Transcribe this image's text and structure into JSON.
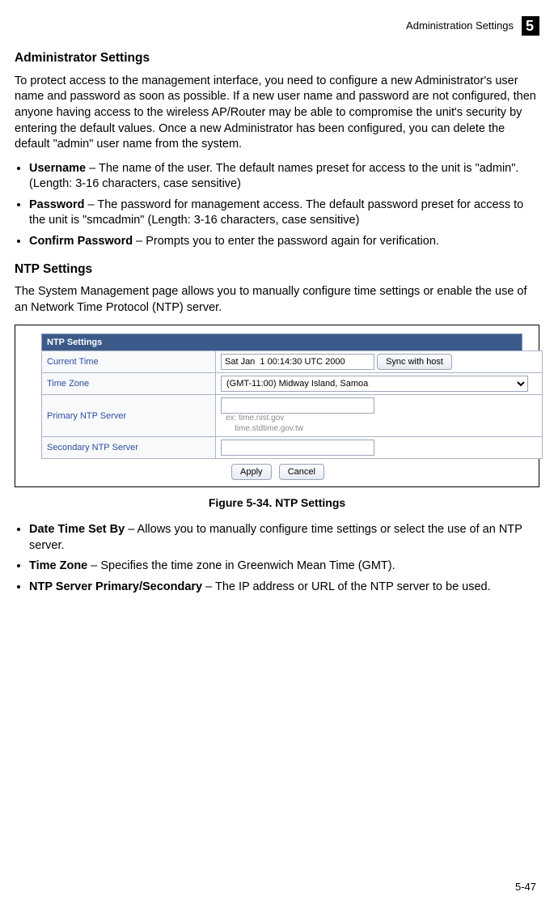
{
  "header": {
    "title": "Administration Settings",
    "chapter": "5"
  },
  "admin": {
    "heading": "Administrator Settings",
    "para": "To protect access to the management interface, you need to configure a new Administrator's user name and password as soon as possible. If a new user name and password are not configured, then anyone having access to the wireless AP/Router may be able to compromise the unit's security by entering the default values. Once a new Administrator has been configured, you can delete the default \"admin\" user name from the system.",
    "items": [
      {
        "label": "Username",
        "text": " – The name of the user. The default names preset for access to the unit is \"admin\". (Length: 3-16 characters, case sensitive)"
      },
      {
        "label": "Password",
        "text": " – The password for management access. The default password preset for access to the unit is \"smcadmin\" (Length: 3-16 characters, case sensitive)"
      },
      {
        "label": "Confirm Password",
        "text": " – Prompts you to enter the password again for verification."
      }
    ]
  },
  "ntp": {
    "heading": "NTP Settings",
    "intro": "The System Management page allows you to manually configure time settings or enable the use of an Network Time Protocol (NTP) server.",
    "panel_title": "NTP Settings",
    "rows": {
      "current_time_label": "Current Time",
      "current_time_value": "Sat Jan  1 00:14:30 UTC 2000",
      "sync_btn": "Sync with host",
      "tz_label": "Time Zone",
      "tz_value": "(GMT-11:00) Midway Island, Samoa",
      "primary_label": "Primary NTP Server",
      "primary_value": "",
      "primary_hint1": "ex: time.nist.gov",
      "primary_hint2": "time.stdtime.gov.tw",
      "secondary_label": "Secondary NTP Server",
      "secondary_value": ""
    },
    "buttons": {
      "apply": "Apply",
      "cancel": "Cancel"
    },
    "caption": "Figure 5-34.   NTP Settings",
    "items": [
      {
        "label": "Date Time Set By",
        "text": " – Allows you to manually configure time settings or select the use of an NTP server."
      },
      {
        "label": "Time Zone",
        "text": " – Specifies the time zone in Greenwich Mean Time (GMT)."
      },
      {
        "label": "NTP Server Primary/Secondary",
        "text": " – The IP address or URL of the NTP server to be used."
      }
    ]
  },
  "page_number": "5-47"
}
